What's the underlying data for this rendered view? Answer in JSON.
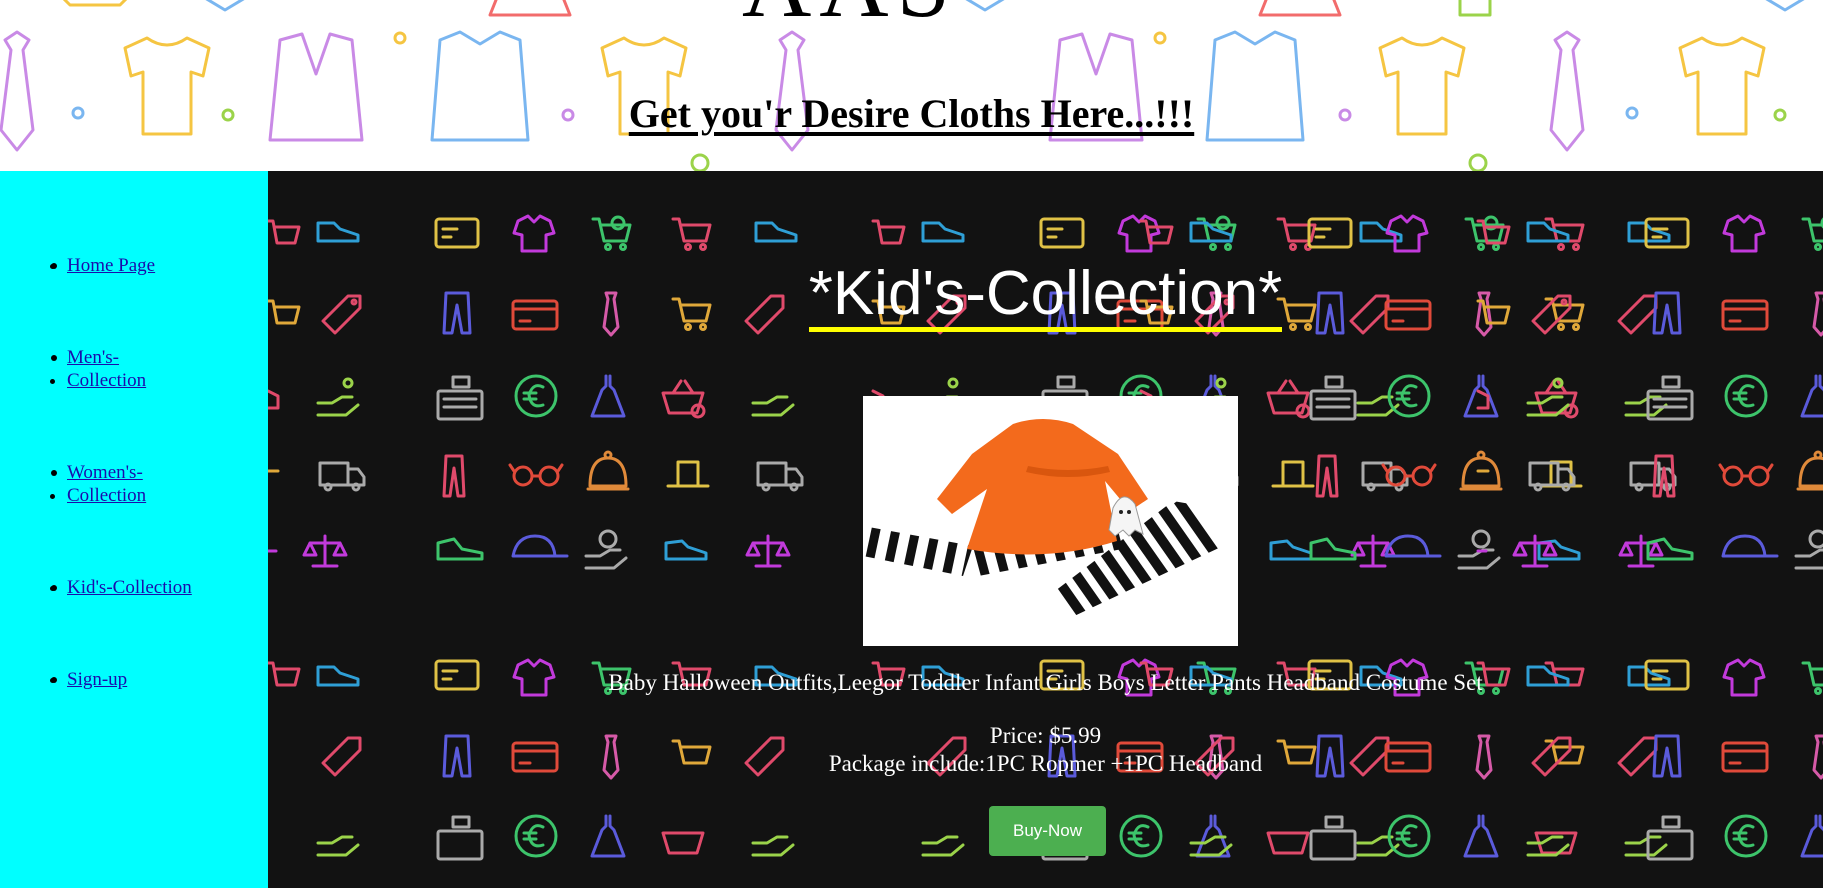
{
  "header": {
    "brand_fragment": "AAS",
    "tagline": "Get you'r Desire Cloths Here...!!!",
    "pattern_icons": [
      "tshirt-icon",
      "blazer-icon",
      "shirt-icon",
      "tie-icon",
      "polo-icon",
      "skirt-icon"
    ]
  },
  "sidebar": {
    "items": [
      {
        "label": "Home Page"
      },
      {
        "label": "Men's-Collection"
      },
      {
        "label": "Women's-Collection"
      },
      {
        "label": "Kid's-Collection"
      },
      {
        "label": "Sign-up"
      }
    ]
  },
  "main": {
    "title": "*Kid's-Collection*",
    "product": {
      "name": "Baby Halloween Outfits,Leegor Toddler Infant Girls Boys Letter Pants Headband Costume Set",
      "price": "Price: $5.99",
      "package": "Package include:1PC Ropmer +1PC Headband",
      "buy_label": "Buy-Now",
      "image_alt": "orange-dress-striped-pants-outfit"
    },
    "pattern_icons": [
      "coupon-icon",
      "shirt-icon",
      "cart-icon",
      "shoe-icon",
      "tag-icon",
      "pants-icon",
      "credit-card-icon",
      "tie-icon",
      "register-icon",
      "euro-icon",
      "dress-icon",
      "basket-icon",
      "hand-icon",
      "glasses-icon",
      "hat-icon",
      "truck-icon",
      "scale-icon",
      "cap-icon",
      "sneaker-icon"
    ]
  },
  "colors": {
    "sidebar_bg": "#00ffff",
    "main_bg": "#121212",
    "title_underline": "#ffff00",
    "buy_button": "#4caf50"
  }
}
